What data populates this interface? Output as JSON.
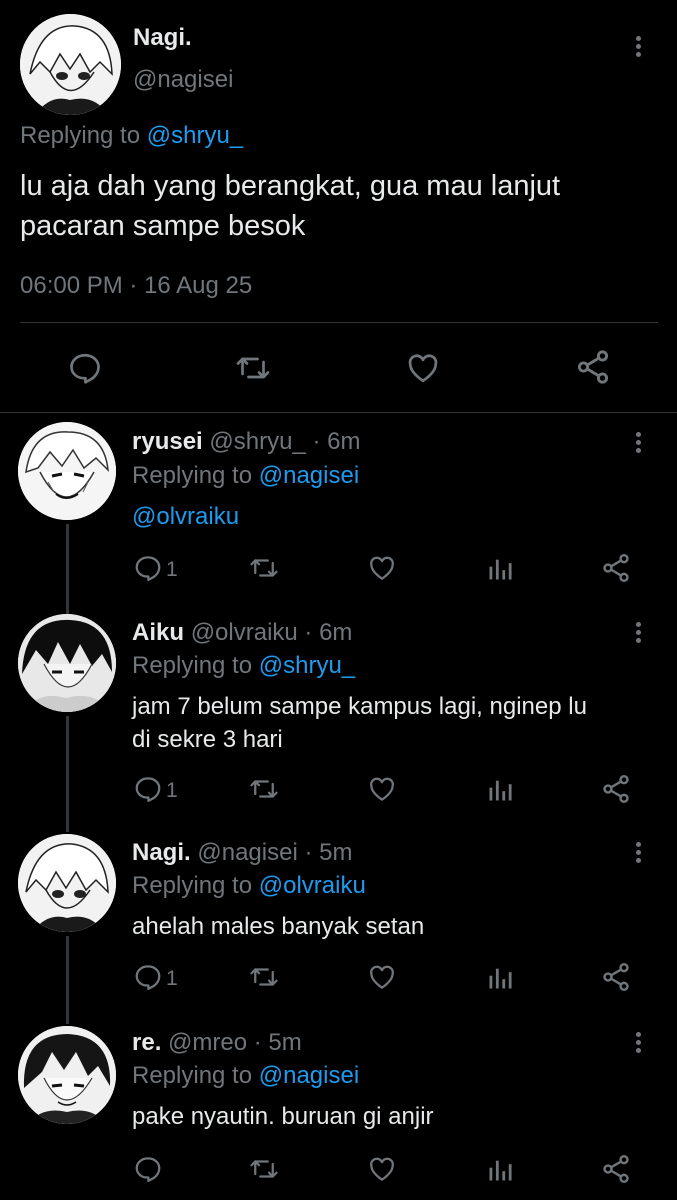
{
  "main_tweet": {
    "name": "Nagi.",
    "handle": "@nagisei",
    "replying_prefix": "Replying to",
    "replying_to": "@shryu_",
    "text_line1": "lu aja dah yang berangkat, gua mau lanjut",
    "text_line2": "pacaran sampe besok",
    "timestamp": "06:00 PM · 16 Aug 25"
  },
  "replies": [
    {
      "name": "ryusei",
      "handle": "@shryu_",
      "time": "· 6m",
      "replying_prefix": "Replying to",
      "replying_to": "@nagisei",
      "text_line1": "@olvraiku",
      "text_line2": "",
      "reply_count": "1"
    },
    {
      "name": "Aiku",
      "handle": "@olvraiku",
      "time": "· 6m",
      "replying_prefix": "Replying to",
      "replying_to": "@shryu_",
      "text_line1": "jam 7 belum sampe kampus lagi, nginep lu",
      "text_line2": "di sekre 3 hari",
      "reply_count": "1"
    },
    {
      "name": "Nagi.",
      "handle": "@nagisei",
      "time": "· 5m",
      "replying_prefix": "Replying to",
      "replying_to": "@olvraiku",
      "text_line1": "ahelah males banyak setan",
      "text_line2": "",
      "reply_count": "1"
    },
    {
      "name": "re.",
      "handle": "@mreo",
      "time": "· 5m",
      "replying_prefix": "Replying to",
      "replying_to": "@nagisei",
      "text_line1": "pake nyautin. buruan gi anjir",
      "text_line2": "",
      "reply_count": ""
    }
  ],
  "colors": {
    "background": "#000000",
    "text": "#e7e9ea",
    "muted": "#71767b",
    "accent": "#1d9bf0",
    "divider": "#2f3336"
  },
  "icons": [
    "more-vertical-icon",
    "reply-icon",
    "retweet-icon",
    "like-icon",
    "share-icon",
    "views-icon"
  ]
}
